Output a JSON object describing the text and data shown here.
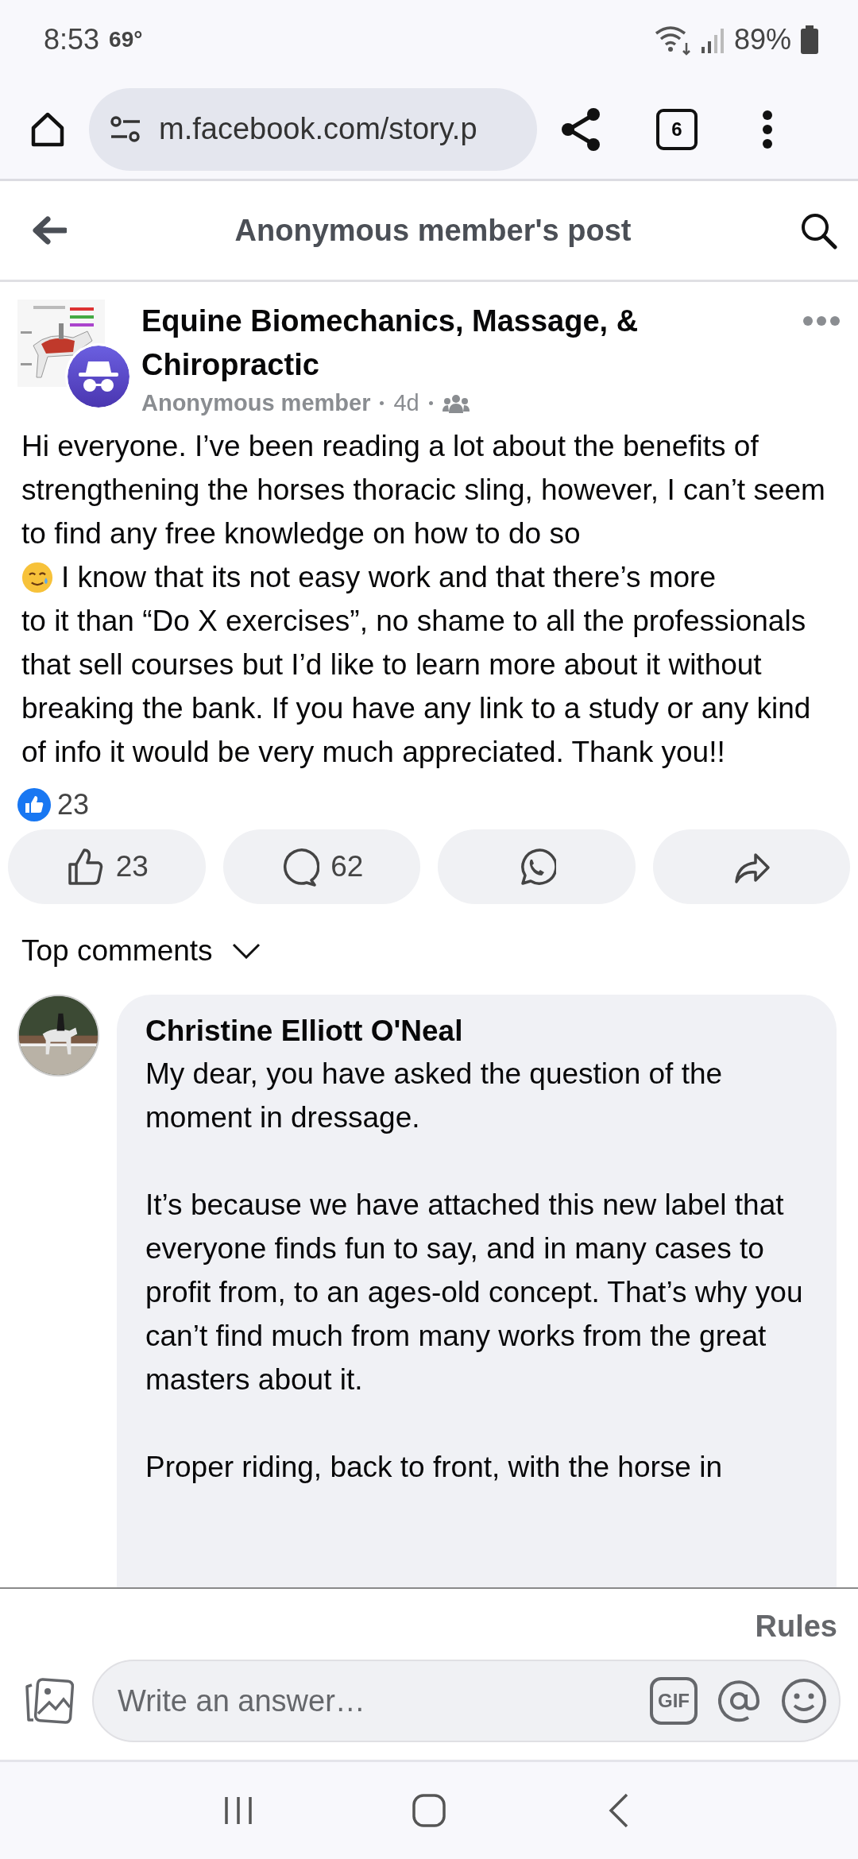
{
  "status_bar": {
    "time": "8:53",
    "temperature": "69°",
    "battery": "89%"
  },
  "browser": {
    "url": "m.facebook.com/story.p",
    "tab_count": "6"
  },
  "header": {
    "title": "Anonymous member's post"
  },
  "post": {
    "group": "Equine Biomechanics, Massage, & Chiropractic",
    "author": "Anonymous member",
    "time": "4d",
    "body": [
      {
        "kind": "text",
        "text": "Hi everyone. I’ve been reading a lot about the benefits of strengthening the horses thoracic sling, however, I can’t seem to find any free knowledge on how to do so"
      },
      {
        "kind": "emoji_line",
        "text": "I know that its not easy work and that there’s more"
      },
      {
        "kind": "text",
        "text": "to it than “Do X exercises”, no shame to all the professionals that sell courses but I’d like to learn more about it without breaking the bank. If you have any link to a study or any kind of info it would be very much appreciated. Thank you!!"
      }
    ],
    "reaction_count": "23"
  },
  "actions": [
    {
      "kind": "like",
      "count": "23"
    },
    {
      "kind": "comment",
      "count": "62"
    },
    {
      "kind": "whatsapp"
    },
    {
      "kind": "share"
    }
  ],
  "comments_filter": "Top comments",
  "comments": [
    {
      "author": "Christine Elliott O'Neal",
      "paragraphs": [
        "My dear, you have asked the question of the moment in dressage.",
        "It’s because we have attached this new label that everyone finds fun to say, and in many cases to profit from, to an ages-old concept. That’s why you can’t find much from many works from the great masters about it.",
        "Proper riding, back to front, with the horse in"
      ]
    }
  ],
  "composer": {
    "rules": "Rules",
    "placeholder": "Write an answer…",
    "gif_label": "GIF"
  }
}
